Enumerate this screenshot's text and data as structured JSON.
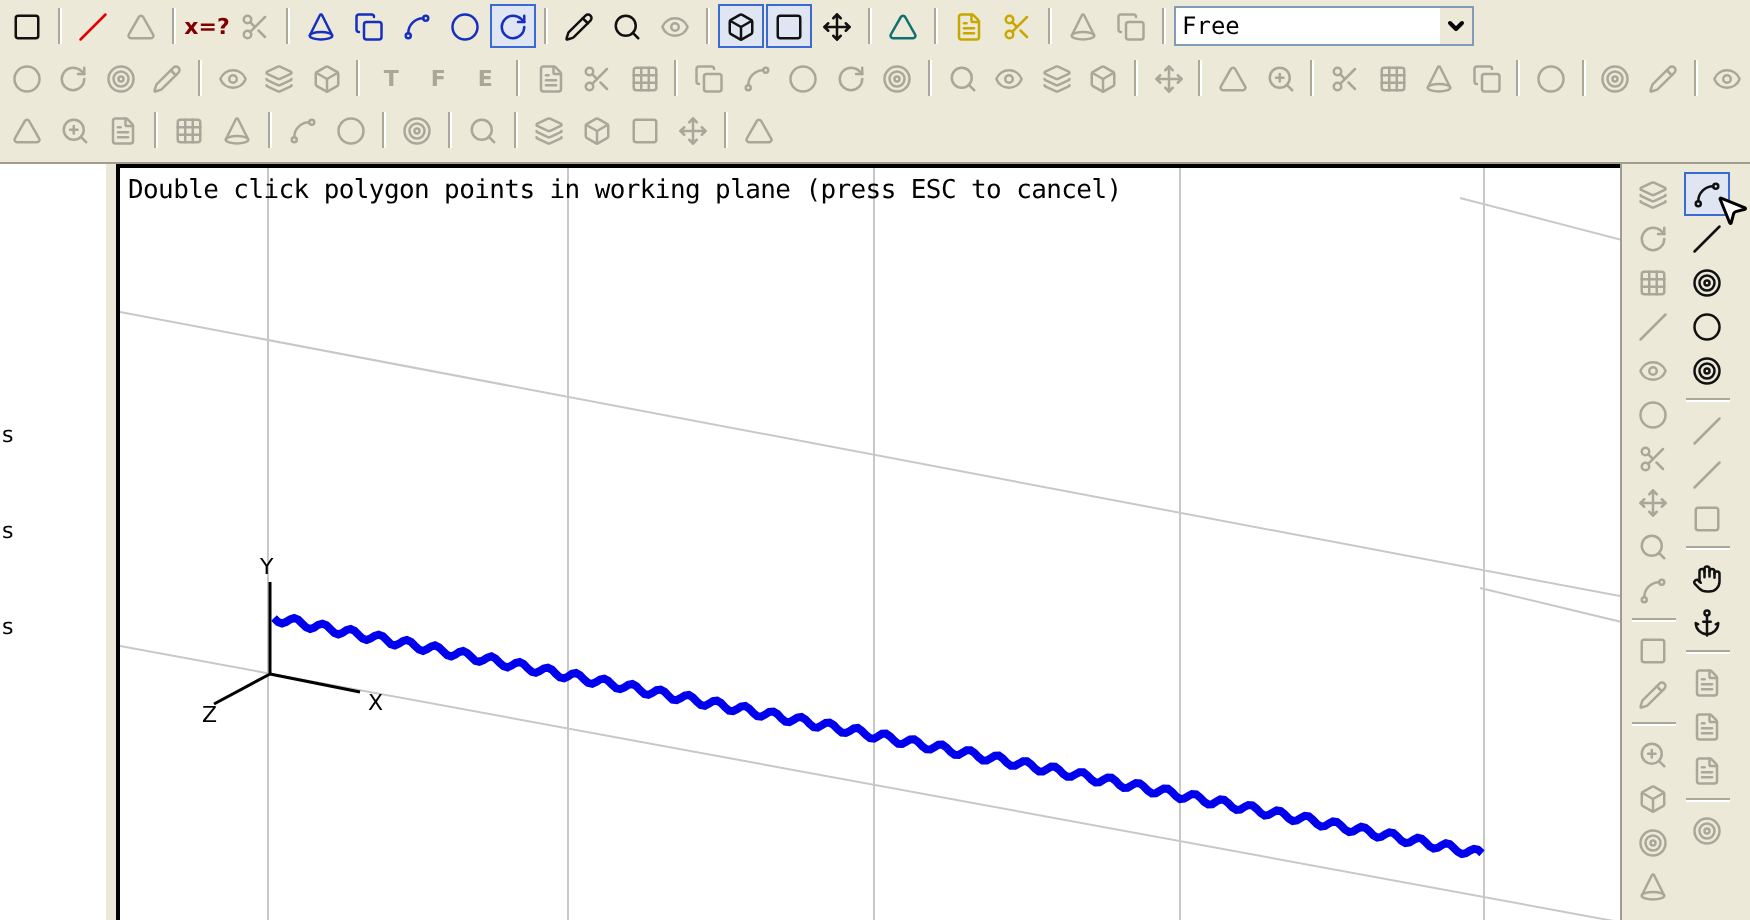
{
  "toolbars": [
    {
      "items": [
        {
          "kind": "button",
          "disabled": false,
          "pressed": false
        },
        {
          "kind": "separator"
        },
        {
          "kind": "button",
          "disabled": false,
          "pressed": false,
          "color": "#e00000"
        },
        {
          "kind": "button",
          "disabled": true,
          "pressed": false
        },
        {
          "kind": "separator"
        },
        {
          "kind": "text-button",
          "label": "x=?",
          "disabled": false,
          "pressed": false
        },
        {
          "kind": "button",
          "disabled": true,
          "pressed": false
        },
        {
          "kind": "separator"
        },
        {
          "kind": "button",
          "disabled": false,
          "pressed": false,
          "color": "#1530c0"
        },
        {
          "kind": "button",
          "disabled": false,
          "pressed": false,
          "color": "#1530c0"
        },
        {
          "kind": "button",
          "disabled": false,
          "pressed": false,
          "color": "#1530c0"
        },
        {
          "kind": "button",
          "disabled": false,
          "pressed": false,
          "color": "#1530c0"
        },
        {
          "kind": "button",
          "disabled": false,
          "pressed": true,
          "color": "#1530c0"
        },
        {
          "kind": "separator"
        },
        {
          "kind": "button",
          "disabled": false,
          "pressed": false
        },
        {
          "kind": "button",
          "disabled": false,
          "pressed": false
        },
        {
          "kind": "button",
          "disabled": true,
          "pressed": false
        },
        {
          "kind": "separator"
        },
        {
          "kind": "button",
          "disabled": false,
          "pressed": true
        },
        {
          "kind": "button",
          "disabled": false,
          "pressed": true
        },
        {
          "kind": "button",
          "disabled": false,
          "pressed": false
        },
        {
          "kind": "separator"
        },
        {
          "kind": "button",
          "disabled": false,
          "pressed": false,
          "color": "#107070"
        },
        {
          "kind": "separator"
        },
        {
          "kind": "button",
          "disabled": false,
          "pressed": false,
          "color": "#c8a800"
        },
        {
          "kind": "button",
          "disabled": false,
          "pressed": false,
          "color": "#c8a800"
        },
        {
          "kind": "separator"
        },
        {
          "kind": "button",
          "disabled": true,
          "pressed": false
        },
        {
          "kind": "button",
          "disabled": true,
          "pressed": false
        },
        {
          "kind": "separator"
        },
        {
          "kind": "dropdown",
          "value": "Free"
        }
      ]
    },
    {
      "items": [
        {
          "kind": "button",
          "disabled": true,
          "pressed": false
        },
        {
          "kind": "button",
          "disabled": true,
          "pressed": false
        },
        {
          "kind": "button",
          "disabled": true,
          "pressed": false
        },
        {
          "kind": "button",
          "disabled": true,
          "pressed": false
        },
        {
          "kind": "separator"
        },
        {
          "kind": "button",
          "disabled": true,
          "pressed": false
        },
        {
          "kind": "button",
          "disabled": true,
          "pressed": false
        },
        {
          "kind": "button",
          "disabled": true,
          "pressed": false
        },
        {
          "kind": "separator"
        },
        {
          "kind": "text-button",
          "label": "T",
          "disabled": true,
          "pressed": false
        },
        {
          "kind": "text-button",
          "label": "F",
          "disabled": true,
          "pressed": false
        },
        {
          "kind": "text-button",
          "label": "E",
          "disabled": true,
          "pressed": false
        },
        {
          "kind": "separator"
        },
        {
          "kind": "button",
          "disabled": true,
          "pressed": false
        },
        {
          "kind": "button",
          "disabled": true,
          "pressed": false
        },
        {
          "kind": "button",
          "disabled": true,
          "pressed": false
        },
        {
          "kind": "separator"
        },
        {
          "kind": "button",
          "disabled": true,
          "pressed": false
        },
        {
          "kind": "button",
          "disabled": true,
          "pressed": false
        },
        {
          "kind": "button",
          "disabled": true,
          "pressed": false
        },
        {
          "kind": "button",
          "disabled": true,
          "pressed": false
        },
        {
          "kind": "button",
          "disabled": true,
          "pressed": false
        },
        {
          "kind": "separator"
        },
        {
          "kind": "button",
          "disabled": true,
          "pressed": false
        },
        {
          "kind": "button",
          "disabled": true,
          "pressed": false
        },
        {
          "kind": "button",
          "disabled": true,
          "pressed": false
        },
        {
          "kind": "button",
          "disabled": true,
          "pressed": false
        },
        {
          "kind": "separator"
        },
        {
          "kind": "button",
          "disabled": true,
          "pressed": false
        },
        {
          "kind": "separator"
        },
        {
          "kind": "button",
          "disabled": true,
          "pressed": false
        },
        {
          "kind": "button",
          "disabled": true,
          "pressed": false
        },
        {
          "kind": "separator"
        },
        {
          "kind": "button",
          "disabled": true,
          "pressed": false
        },
        {
          "kind": "button",
          "disabled": true,
          "pressed": false
        },
        {
          "kind": "button",
          "disabled": true,
          "pressed": false
        },
        {
          "kind": "button",
          "disabled": true,
          "pressed": false
        },
        {
          "kind": "separator"
        },
        {
          "kind": "button",
          "disabled": true,
          "pressed": false
        },
        {
          "kind": "separator"
        },
        {
          "kind": "button",
          "disabled": true,
          "pressed": false
        },
        {
          "kind": "button",
          "disabled": true,
          "pressed": false
        },
        {
          "kind": "separator"
        },
        {
          "kind": "button",
          "disabled": true,
          "pressed": false
        }
      ]
    },
    {
      "items": [
        {
          "kind": "button",
          "disabled": true,
          "pressed": false
        },
        {
          "kind": "button",
          "disabled": true,
          "pressed": false
        },
        {
          "kind": "button",
          "disabled": true,
          "pressed": false
        },
        {
          "kind": "separator"
        },
        {
          "kind": "button",
          "disabled": true,
          "pressed": false
        },
        {
          "kind": "button",
          "disabled": true,
          "pressed": false
        },
        {
          "kind": "separator"
        },
        {
          "kind": "button",
          "disabled": true,
          "pressed": false
        },
        {
          "kind": "button",
          "disabled": true,
          "pressed": false
        },
        {
          "kind": "separator"
        },
        {
          "kind": "button",
          "disabled": true,
          "pressed": false
        },
        {
          "kind": "separator"
        },
        {
          "kind": "button",
          "disabled": true,
          "pressed": false
        },
        {
          "kind": "separator"
        },
        {
          "kind": "button",
          "disabled": true,
          "pressed": false
        },
        {
          "kind": "button",
          "disabled": true,
          "pressed": false
        },
        {
          "kind": "button",
          "disabled": true,
          "pressed": false
        },
        {
          "kind": "button",
          "disabled": true,
          "pressed": false
        },
        {
          "kind": "separator"
        },
        {
          "kind": "button",
          "disabled": true,
          "pressed": false
        }
      ]
    }
  ],
  "side_panel": {
    "items": [
      "s",
      "s",
      "s"
    ]
  },
  "viewport": {
    "message": "Double click polygon points in working plane (press ESC to cancel)",
    "axes": [
      {
        "label": "Y"
      },
      {
        "label": "X"
      },
      {
        "label": "Z"
      }
    ]
  },
  "side_toolbars": [
    {
      "items": [
        {
          "kind": "button",
          "disabled": true,
          "pressed": false
        },
        {
          "kind": "button",
          "disabled": true,
          "pressed": false
        },
        {
          "kind": "button",
          "disabled": true,
          "pressed": false
        },
        {
          "kind": "button",
          "disabled": true,
          "pressed": false
        },
        {
          "kind": "button",
          "disabled": true,
          "pressed": false
        },
        {
          "kind": "button",
          "disabled": true,
          "pressed": false
        },
        {
          "kind": "button",
          "disabled": true,
          "pressed": false
        },
        {
          "kind": "button",
          "disabled": true,
          "pressed": false
        },
        {
          "kind": "button",
          "disabled": true,
          "pressed": false
        },
        {
          "kind": "button",
          "disabled": true,
          "pressed": false
        },
        {
          "kind": "separator"
        },
        {
          "kind": "button",
          "disabled": true,
          "pressed": false
        },
        {
          "kind": "button",
          "disabled": true,
          "pressed": false
        },
        {
          "kind": "separator"
        },
        {
          "kind": "button",
          "disabled": true,
          "pressed": false
        },
        {
          "kind": "button",
          "disabled": true,
          "pressed": false
        },
        {
          "kind": "button",
          "disabled": true,
          "pressed": false
        },
        {
          "kind": "button",
          "disabled": true,
          "pressed": false
        }
      ]
    },
    {
      "items": [
        {
          "kind": "button",
          "disabled": false,
          "pressed": true
        },
        {
          "kind": "button",
          "disabled": false,
          "pressed": false
        },
        {
          "kind": "button",
          "disabled": false,
          "pressed": false
        },
        {
          "kind": "button",
          "disabled": false,
          "pressed": false
        },
        {
          "kind": "button",
          "disabled": false,
          "pressed": false
        },
        {
          "kind": "separator"
        },
        {
          "kind": "button",
          "disabled": true,
          "pressed": false
        },
        {
          "kind": "button",
          "disabled": true,
          "pressed": false
        },
        {
          "kind": "button",
          "disabled": true,
          "pressed": false
        },
        {
          "kind": "separator"
        },
        {
          "kind": "button",
          "disabled": false,
          "pressed": false
        },
        {
          "kind": "button",
          "disabled": false,
          "pressed": false
        },
        {
          "kind": "separator"
        },
        {
          "kind": "button",
          "disabled": true,
          "pressed": false
        },
        {
          "kind": "button",
          "disabled": true,
          "pressed": false
        },
        {
          "kind": "button",
          "disabled": true,
          "pressed": false
        },
        {
          "kind": "separator"
        },
        {
          "kind": "button",
          "disabled": true,
          "pressed": false
        }
      ]
    }
  ]
}
